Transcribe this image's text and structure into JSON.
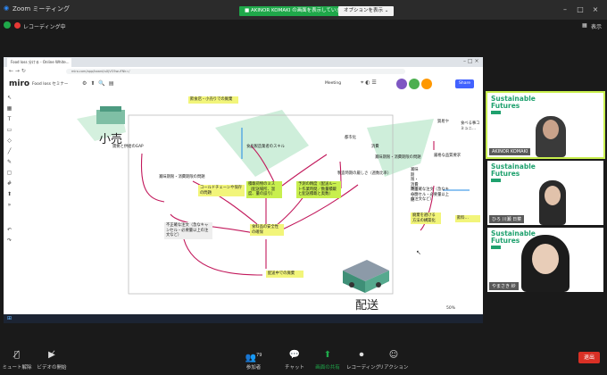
{
  "zoom": {
    "title": "Zoom ミーティング",
    "share_banner": "■ AKINOR KOMAKI の画面を表示しています",
    "options_button": "オプションを表示 ⌄",
    "recording": "レコーディング中",
    "view_button": "表示",
    "controls": [
      {
        "icon": "mic-muted-icon",
        "label": "ミュート解除"
      },
      {
        "icon": "video-off-icon",
        "label": "ビデオの開始"
      },
      {
        "icon": "participants-icon",
        "label": "参加者",
        "count": "79"
      },
      {
        "icon": "chat-icon",
        "label": "チャット"
      },
      {
        "icon": "share-screen-icon",
        "label": "画面の共有"
      },
      {
        "icon": "record-icon",
        "label": "レコーディング"
      },
      {
        "icon": "reaction-icon",
        "label": "リアクション"
      }
    ],
    "end_button": "退出",
    "accent_colors": {
      "share_green": "#1fa84a",
      "end_red": "#d93025",
      "speaker_outline": "#c8ef4e"
    }
  },
  "browser": {
    "tab_title": "Food loss 分ける - Online White...",
    "url": "miro.com/app/board/uXjVO5wuFNk=/"
  },
  "miro": {
    "logo": "miro",
    "board_name": "Food loss セミナー",
    "meeting_label": "Meeting",
    "share_button": "Share",
    "zoom_level": "50%",
    "labels": {
      "retail": "小売",
      "delivery": "配送"
    },
    "notes": [
      {
        "id": "n1",
        "text": "飲食店・小売りでの廃棄",
        "color": "yellow"
      },
      {
        "id": "n2",
        "text": "需要と供給のGAP",
        "color": "plain"
      },
      {
        "id": "n3",
        "text": "賞味期限・消費期限の問題",
        "color": "plain"
      },
      {
        "id": "n4",
        "text": "食品製造業者のスキル",
        "color": "plain"
      },
      {
        "id": "n5",
        "text": "都市化",
        "color": "plain"
      },
      {
        "id": "n6",
        "text": "消費",
        "color": "plain"
      },
      {
        "id": "n7",
        "text": "賞味期限・消費期限の問題",
        "color": "plain"
      },
      {
        "id": "n8",
        "text": "コールドチェーンや保存の問題",
        "color": "yellow"
      },
      {
        "id": "n9",
        "text": "積載荷物のミス（配送場所、温度、量の誤り）",
        "color": "green"
      },
      {
        "id": "n10",
        "text": "予測の精度（配送ルート作業時間／数量積載と配送積載と奥数）",
        "color": "green"
      },
      {
        "id": "n11",
        "text": "製造時期の厳しさ（週数比率）",
        "color": "plain"
      },
      {
        "id": "n12",
        "text": "不正確な注文（急なキャンセル・必要量以上の注文など）",
        "color": "plain"
      },
      {
        "id": "n13",
        "text": "食料品の安全性の確保",
        "color": "yellow"
      },
      {
        "id": "n14",
        "text": "配送中での廃棄",
        "color": "yellow"
      },
      {
        "id": "n15",
        "text": "貿易や",
        "color": "plain"
      },
      {
        "id": "n16",
        "text": "食べる事コミュニ…",
        "color": "plain"
      },
      {
        "id": "n17",
        "text": "厳格な品質要求",
        "color": "plain"
      },
      {
        "id": "n18",
        "text": "賞味期限・消費期限の問題",
        "color": "plain"
      },
      {
        "id": "n19",
        "text": "不正確な注文（急なキャンセル・必要量以上の注文など）",
        "color": "plain"
      },
      {
        "id": "n20",
        "text": "廃棄を避ける方法の構築化",
        "color": "yellow"
      },
      {
        "id": "n21",
        "text": "飲料…",
        "color": "yellow"
      }
    ]
  },
  "participants": [
    {
      "brand": "Sustainable Futures",
      "name": "AKINOR KOMAKI",
      "active": true
    },
    {
      "brand": "Sustainable Futures",
      "name": "ひろ 川瀬 日菜",
      "active": false
    },
    {
      "brand": "Sustainable Futures",
      "name": "やまさき 紗",
      "active": false
    }
  ]
}
